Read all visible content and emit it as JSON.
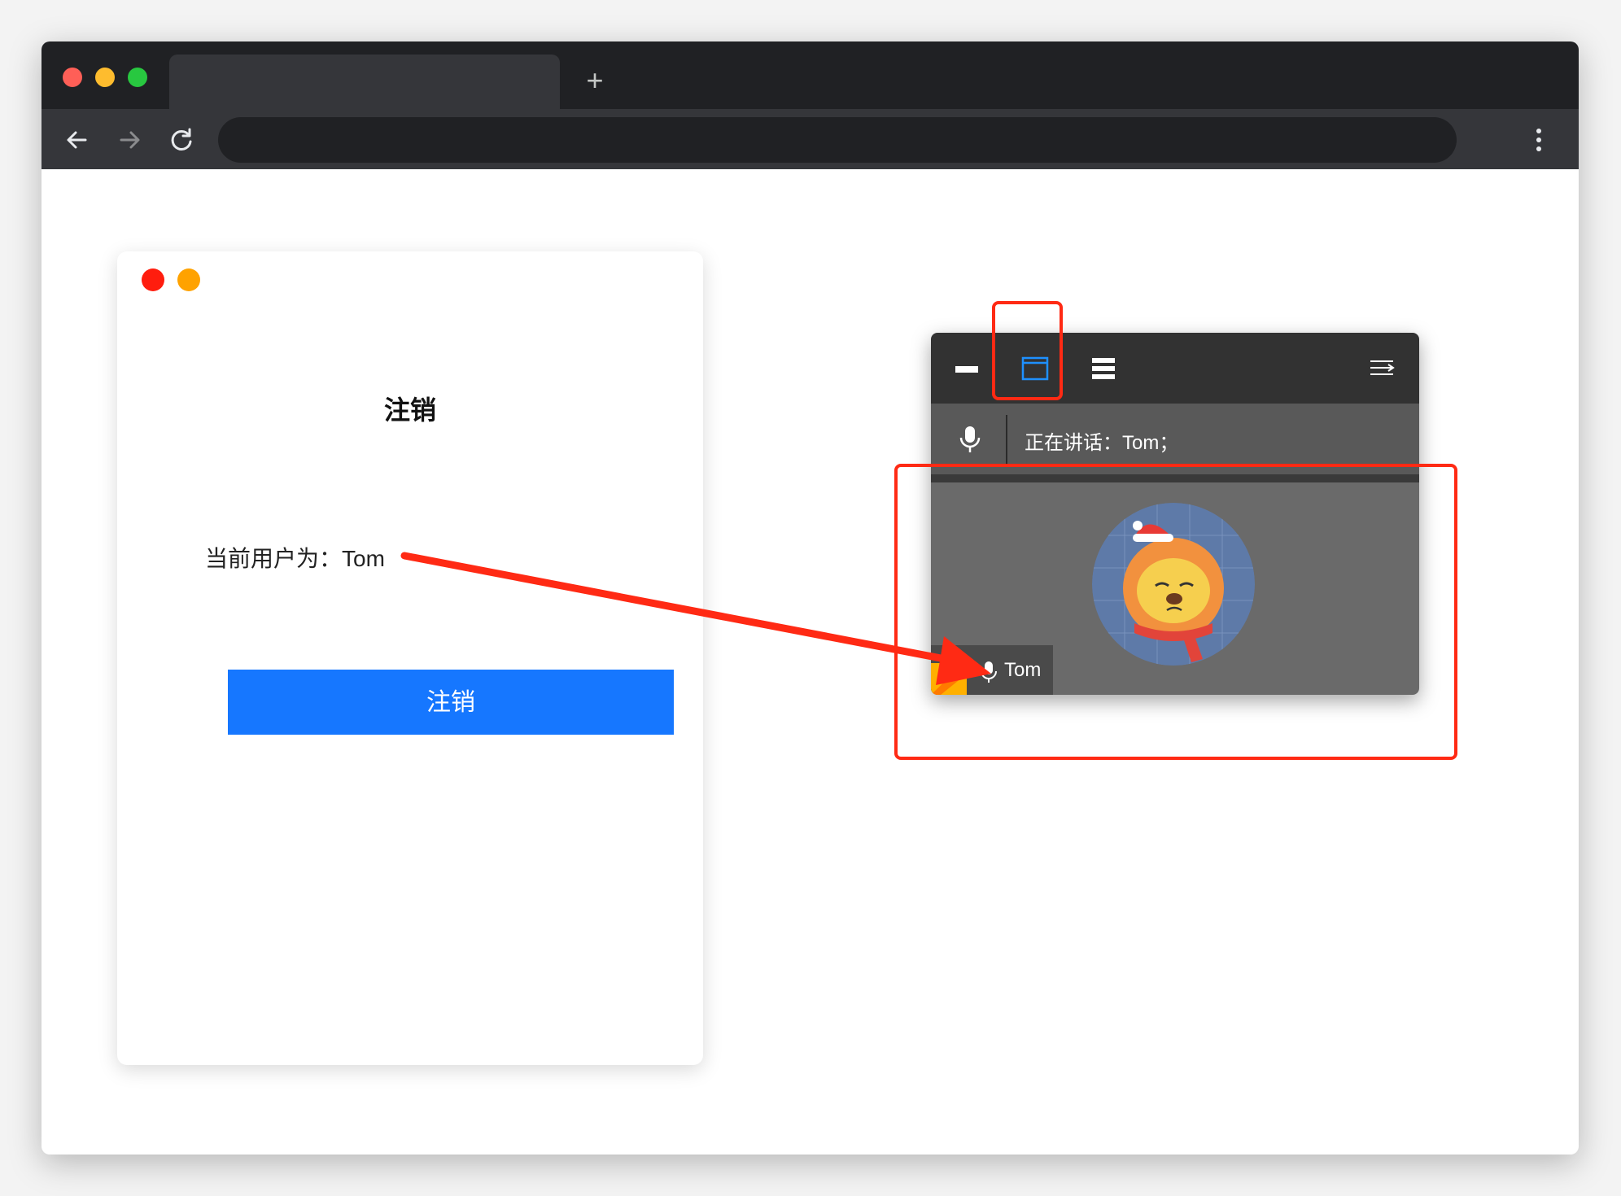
{
  "card": {
    "title": "注销",
    "user_line": "当前用户为：Tom",
    "logout_button": "注销"
  },
  "widget": {
    "speaking": "正在讲话：Tom；",
    "participant_name": "Tom"
  },
  "colors": {
    "primary_button": "#1677ff",
    "annotation": "#ff2a14",
    "active_icon": "#1e90ff"
  },
  "icons": {
    "minimize": "minimize-icon",
    "window": "window-mode-icon",
    "list": "list-mode-icon",
    "collapse": "collapse-menu-icon",
    "mic": "microphone-icon"
  }
}
